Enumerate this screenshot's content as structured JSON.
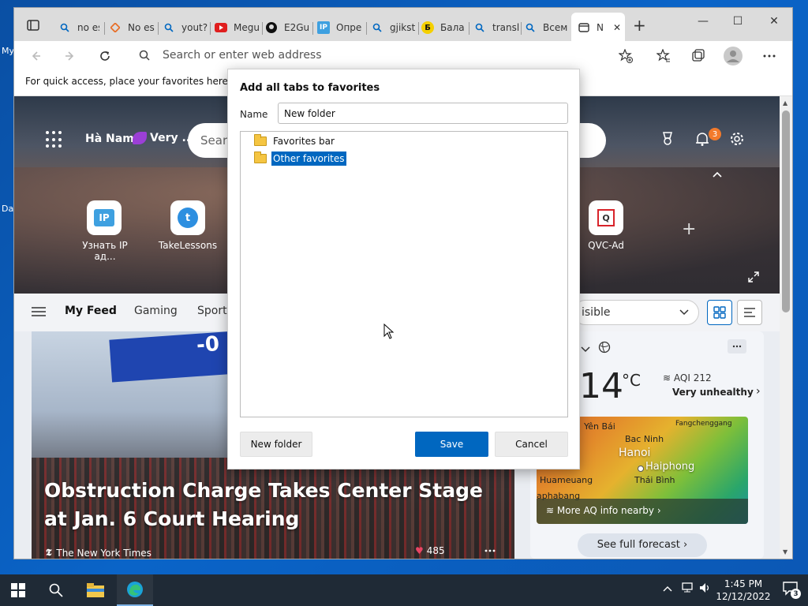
{
  "desktop": {
    "icon_label_1": "My",
    "icon_label_2": "Da"
  },
  "browser": {
    "tabs": [
      {
        "label": "no es",
        "icon": "search-icon"
      },
      {
        "label": "No es",
        "icon": "diamond-icon"
      },
      {
        "label": "yout?",
        "icon": "search-icon"
      },
      {
        "label": "Megu",
        "icon": "youtube-icon"
      },
      {
        "label": "E2Gu",
        "icon": "github-icon"
      },
      {
        "label": "Опре",
        "icon": "ip-icon"
      },
      {
        "label": "gjikst",
        "icon": "search-icon"
      },
      {
        "label": "Бала",
        "icon": "b-icon"
      },
      {
        "label": "transl",
        "icon": "search-icon"
      },
      {
        "label": "Всем",
        "icon": "search-icon"
      },
      {
        "label": "N",
        "icon": "newtab-icon"
      }
    ],
    "tab_icon_glyphs": {
      "ip": "IP",
      "b": "Б"
    },
    "new_tab_glyph": "+",
    "window_controls": {
      "minimize": "—",
      "maximize": "☐",
      "close": "✕"
    },
    "address_placeholder": "Search or enter web address",
    "favorites_hint": "For quick access, place your favorites here on t"
  },
  "page": {
    "location": "Hà Nam",
    "weather_chip": "Very ...",
    "search_placeholder": "Sear",
    "notification_count": "3",
    "tiles": [
      {
        "label": "Узнать IP ад...",
        "glyph": "IP"
      },
      {
        "label": "TakeLessons",
        "glyph": "t"
      },
      {
        "label": "QVC-Ad",
        "glyph": "Q"
      }
    ],
    "add_tile_glyph": "+",
    "feed": {
      "my_feed": "My Feed",
      "gaming": "Gaming",
      "sports": "Sports",
      "visible_select": "isible"
    },
    "news": {
      "flag_text": "-0",
      "headline": "Obstruction Charge Takes Center Stage at Jan. 6 Court Hearing",
      "source": "The New York Times",
      "reaction_count": "485"
    },
    "weather": {
      "temperature": "14",
      "unit": "°C",
      "aqi": "AQI 212",
      "aqi_desc": "Very unhealthy",
      "map_labels": [
        "Yên Bái",
        "Bac Ninh",
        "Hanoi",
        "Haiphong",
        "Thái Bình",
        "Huameuang",
        "Fangchenggang",
        "aphabang"
      ],
      "map_footer": "More AQ info nearby",
      "forecast_button": "See full forecast"
    }
  },
  "dialog": {
    "title": "Add all tabs to favorites",
    "name_label": "Name",
    "name_value": "New folder",
    "folders": [
      {
        "label": "Favorites bar",
        "selected": false
      },
      {
        "label": "Other favorites",
        "selected": true
      }
    ],
    "new_folder_button": "New folder",
    "save_button": "Save",
    "cancel_button": "Cancel"
  },
  "taskbar": {
    "time": "1:45 PM",
    "date": "12/12/2022",
    "notification_count": "3"
  },
  "colors": {
    "accent": "#0067c0",
    "desktop": "#0a64c8",
    "taskbar": "#1f2a36",
    "badge": "#f37a2b"
  }
}
